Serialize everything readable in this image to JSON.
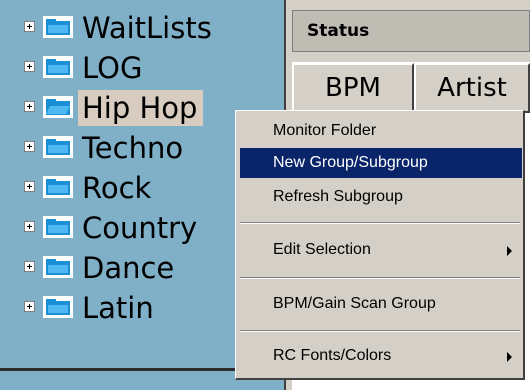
{
  "tree": {
    "items": [
      {
        "label": "WaitLists",
        "icon": "folder-icon"
      },
      {
        "label": "LOG",
        "icon": "folder-icon"
      },
      {
        "label": "Hip Hop",
        "icon": "folder-open-icon",
        "selected": true
      },
      {
        "label": "Techno",
        "icon": "folder-icon"
      },
      {
        "label": "Rock",
        "icon": "folder-icon"
      },
      {
        "label": "Country",
        "icon": "folder-icon"
      },
      {
        "label": "Dance",
        "icon": "folder-icon"
      },
      {
        "label": "Latin",
        "icon": "folder-icon"
      }
    ]
  },
  "status_bar": {
    "label": "Status"
  },
  "columns": [
    {
      "label": "BPM"
    },
    {
      "label": "Artist"
    }
  ],
  "context_menu": {
    "items": [
      {
        "label": "Monitor Folder",
        "submenu": false,
        "highlighted": false
      },
      {
        "label": "New Group/Subgroup",
        "submenu": false,
        "highlighted": true
      },
      {
        "label": "Refresh Subgroup",
        "submenu": false,
        "highlighted": false
      },
      {
        "label": "Edit Selection",
        "submenu": true,
        "highlighted": false
      },
      {
        "label": "BPM/Gain Scan Group",
        "submenu": false,
        "highlighted": false
      },
      {
        "label": "RC Fonts/Colors",
        "submenu": true,
        "highlighted": false
      }
    ]
  },
  "colors": {
    "tree_background": "#7fb0c8",
    "menu_highlight": "#0a246a",
    "folder_icon": "#1a8fd6"
  }
}
